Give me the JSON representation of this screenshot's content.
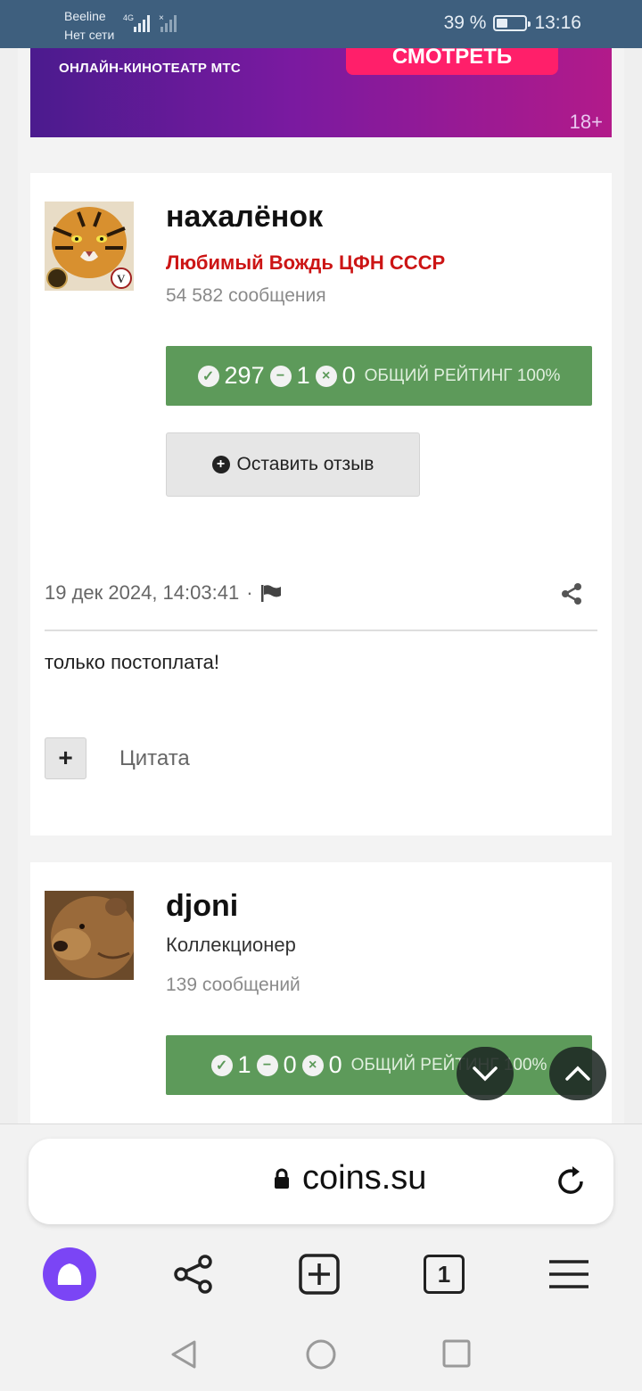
{
  "status_bar": {
    "carrier": "Beeline",
    "network_status": "Нет сети",
    "network_type": "4G",
    "battery_percent": "39 %",
    "battery_level": 0.39,
    "time": "13:16"
  },
  "ad_banner": {
    "subtitle": "ОНЛАЙН-КИНОТЕАТР МТС",
    "cta": "СМОТРЕТЬ",
    "age_rating": "18+"
  },
  "posts": [
    {
      "username": "нахалёнок",
      "role": "Любимый Вождь ЦФН СССР",
      "message_count": "54 582 сообщения",
      "rating": {
        "positive": "297",
        "neutral": "1",
        "negative": "0",
        "label": "ОБЩИЙ РЕЙТИНГ 100%"
      },
      "feedback_button": "Оставить отзыв",
      "date": "19 дек 2024, 14:03:41",
      "date_separator": "·",
      "text": "только постоплата!",
      "quote_label": "Цитата",
      "quote_button_symbol": "+"
    },
    {
      "username": "djoni",
      "role": "Коллекционер",
      "message_count": "139 сообщений",
      "rating": {
        "positive": "1",
        "neutral": "0",
        "negative": "0",
        "label": "ОБЩИЙ РЕЙТИНГ 100%"
      }
    }
  ],
  "browser": {
    "url": "coins.su",
    "tab_count": "1",
    "icons": [
      "alice-icon",
      "share-icon",
      "new-tab-icon",
      "tabs-icon",
      "menu-icon",
      "lock-icon",
      "reload-icon"
    ]
  },
  "navigation": {
    "icons": [
      "back-icon",
      "home-icon",
      "recents-icon"
    ]
  },
  "colors": {
    "rating_green": "#5d9a5a",
    "role_red": "#cc1515",
    "status_bar": "#3e5f7e",
    "alice_purple": "#7b45f5"
  }
}
